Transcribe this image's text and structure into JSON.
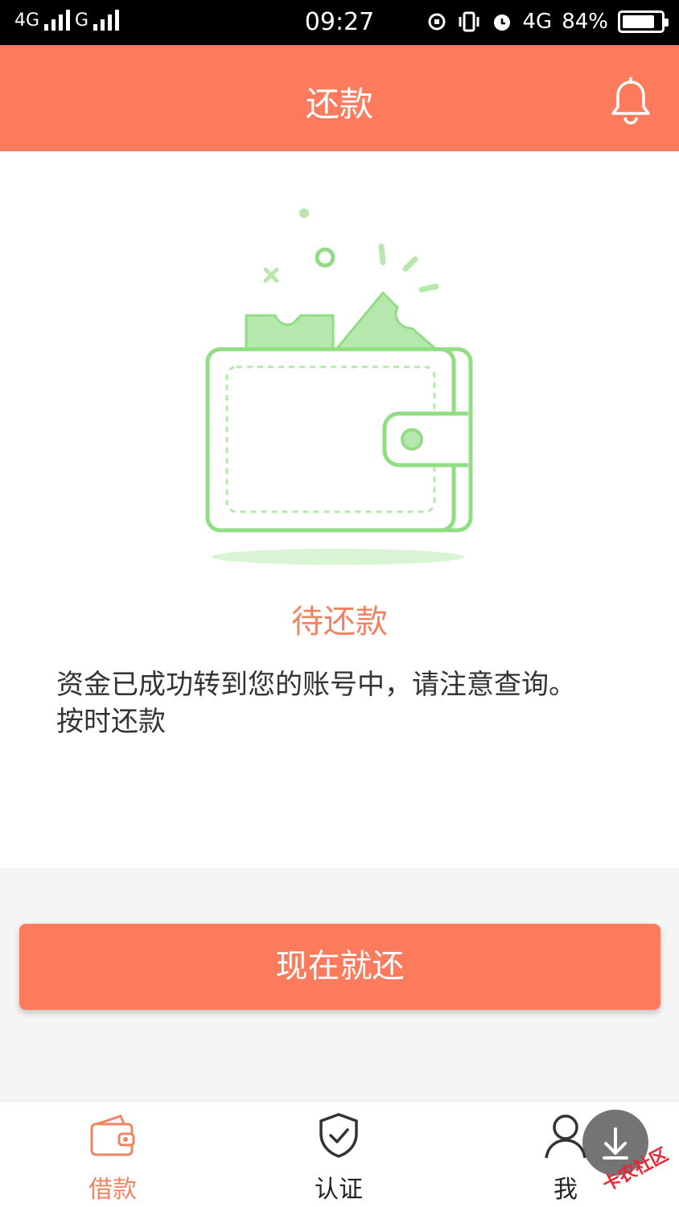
{
  "status_bar": {
    "network1": "4G",
    "network2": "G",
    "time": "09:27",
    "network3": "4G",
    "battery": "84%",
    "battery_level": 0.84
  },
  "header": {
    "title": "还款"
  },
  "main": {
    "status": "待还款",
    "description": "资金已成功转到您的账号中，请注意查询。按时还款",
    "pay_button": "现在就还"
  },
  "tabs": [
    {
      "label": "借款",
      "icon": "wallet-icon",
      "active": true
    },
    {
      "label": "认证",
      "icon": "shield-check-icon",
      "active": false
    },
    {
      "label": "我",
      "icon": "user-icon",
      "active": false
    }
  ],
  "watermark": "卡农社区",
  "colors": {
    "accent": "#fb7b5c",
    "status_text": "#f08462",
    "illustration": "#90dd84"
  }
}
